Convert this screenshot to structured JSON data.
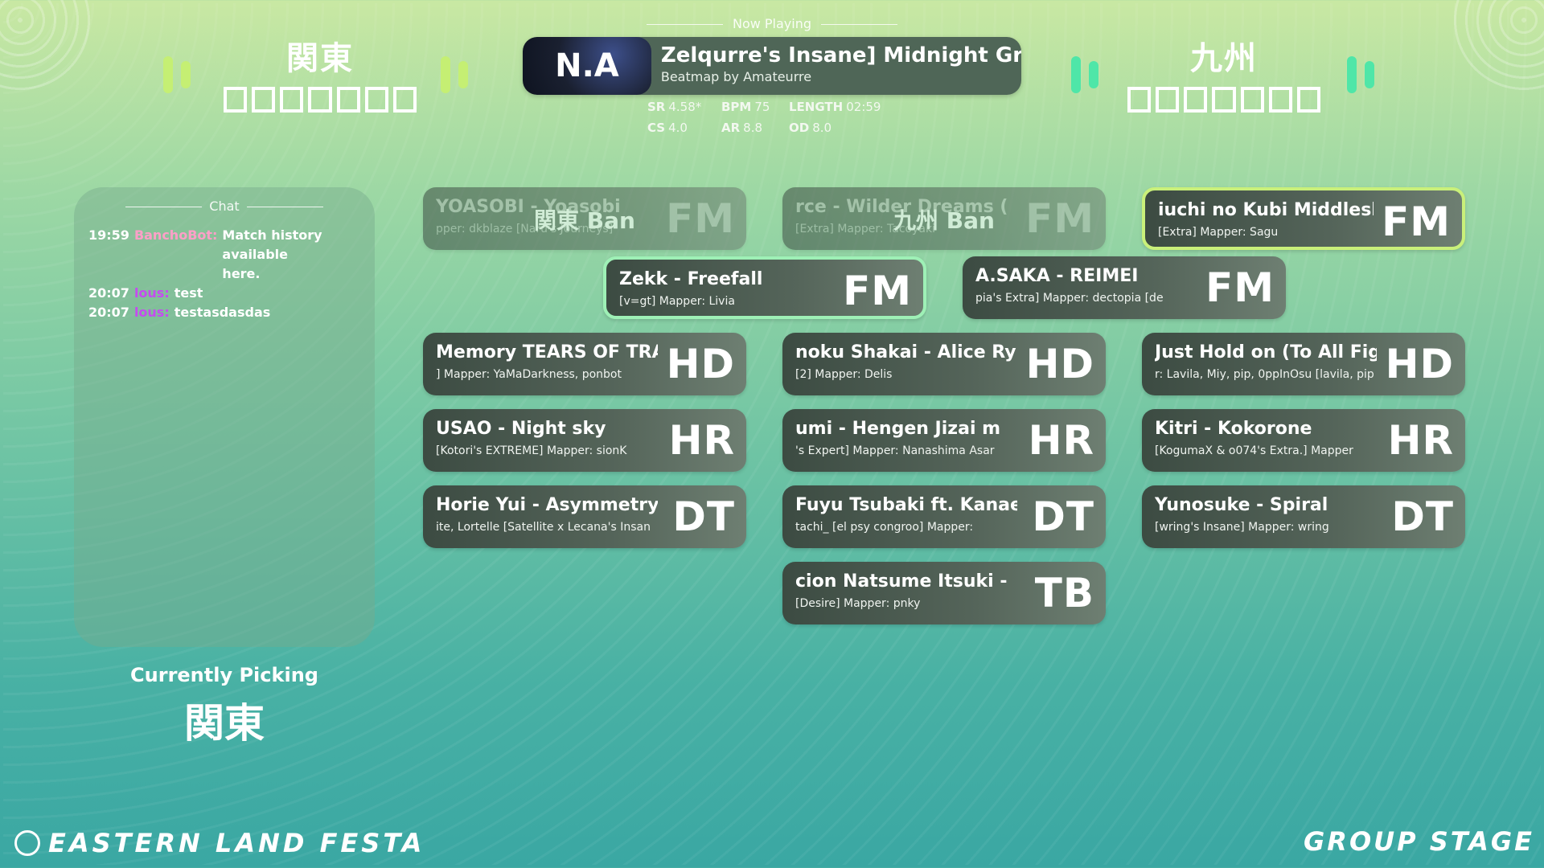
{
  "teams": {
    "left": {
      "name": "関東",
      "stars": [
        "",
        "",
        "",
        "",
        "",
        "",
        ""
      ]
    },
    "right": {
      "name": "九州",
      "stars": [
        "",
        "",
        "",
        "",
        "",
        "",
        ""
      ]
    }
  },
  "colors": {
    "left_bar": "#c5ef73",
    "right_bar": "#4fe6a8"
  },
  "now_playing": {
    "label": "Now Playing",
    "cover_text": "N.A",
    "title": "Zelqurre's Insane]   Midnight Gr",
    "subtitle": "Beatmap by Amateurre",
    "stats": [
      {
        "k": "SR",
        "v": "4.58*"
      },
      {
        "k": "BPM",
        "v": "75"
      },
      {
        "k": "LENGTH",
        "v": "02:59"
      },
      {
        "k": "CS",
        "v": "4.0"
      },
      {
        "k": "AR",
        "v": "8.8"
      },
      {
        "k": "OD",
        "v": "8.0"
      }
    ]
  },
  "chat": {
    "title": "Chat",
    "messages": [
      {
        "time": "19:59",
        "user": "BanchoBot:",
        "user_color": "#ff9fc8",
        "text": "Match history available here."
      },
      {
        "time": "20:07",
        "user": "lous:",
        "user_color": "#c54bf0",
        "text": "test"
      },
      {
        "time": "20:07",
        "user": "lous:",
        "user_color": "#c54bf0",
        "text": "testasdasdas"
      }
    ]
  },
  "picking": {
    "label": "Currently Picking",
    "team": "関東"
  },
  "maps": [
    {
      "title": "YOASOBI - Yoasobi",
      "sub": "pper: dkblaze     [Naru's Journeys]",
      "mod": "FM",
      "ban": "関東 Ban",
      "state": "banned"
    },
    {
      "title": "rce - Wilder Dreams (",
      "sub": "[Extra]      Mapper: Tacoyaki",
      "mod": "FM",
      "ban": "九州 Ban",
      "state": "banned"
    },
    {
      "title": "iuchi no Kubi   Middlesl",
      "sub": "[Extra]      Mapper: Sagu",
      "mod": "FM",
      "ban": "",
      "state": "pick-q"
    },
    {
      "title": "Zekk - Freefall",
      "sub": "[v=gt]      Mapper: Livia",
      "mod": "FM",
      "ban": "",
      "state": "pick-k"
    },
    {
      "title": "A.SAKA - REIMEI",
      "sub": "pia's Extra]      Mapper: dectopia     [de",
      "mod": "FM",
      "ban": "",
      "state": ""
    },
    {
      "title": "Memory    TEARS OF TRA",
      "sub": "]      Mapper: YaMaDarkness, ponbot",
      "mod": "HD",
      "ban": "",
      "state": ""
    },
    {
      "title": "noku Shakai - Alice    Ry",
      "sub": "[2]      Mapper: Delis",
      "mod": "HD",
      "ban": "",
      "state": ""
    },
    {
      "title": "Just Hold on (To All Fig",
      "sub": "r: Lavila, Miy, pip, 0ppInOsu     [lavila, pip",
      "mod": "HD",
      "ban": "",
      "state": ""
    },
    {
      "title": "USAO - Night sky",
      "sub": "[Kotori's EXTREME]      Mapper: sionK",
      "mod": "HR",
      "ban": "",
      "state": ""
    },
    {
      "title": "umi - Hengen Jizai   m",
      "sub": "'s Expert]      Mapper: Nanashima Asar",
      "mod": "HR",
      "ban": "",
      "state": ""
    },
    {
      "title": "Kitri - Kokorone",
      "sub": "[KogumaX & o074's Extra.]      Mapper",
      "mod": "HR",
      "ban": "",
      "state": ""
    },
    {
      "title": "Horie Yui - Asymmetry",
      "sub": "ite, Lortelle      [Satellite x Lecana's Insan",
      "mod": "DT",
      "ban": "",
      "state": ""
    },
    {
      "title": "Fuyu Tsubaki ft. Kanae /",
      "sub": "tachi_     [el psy congroo]      Mapper:",
      "mod": "DT",
      "ban": "",
      "state": ""
    },
    {
      "title": "Yunosuke - Spiral",
      "sub": "[wring's Insane]      Mapper: wring",
      "mod": "DT",
      "ban": "",
      "state": ""
    },
    {
      "title": "cion    Natsume Itsuki -",
      "sub": "[Desire]      Mapper: pnky",
      "mod": "TB",
      "ban": "",
      "state": ""
    }
  ],
  "footer": {
    "left": "EASTERN LAND FESTA",
    "right": "GROUP STAGE"
  }
}
